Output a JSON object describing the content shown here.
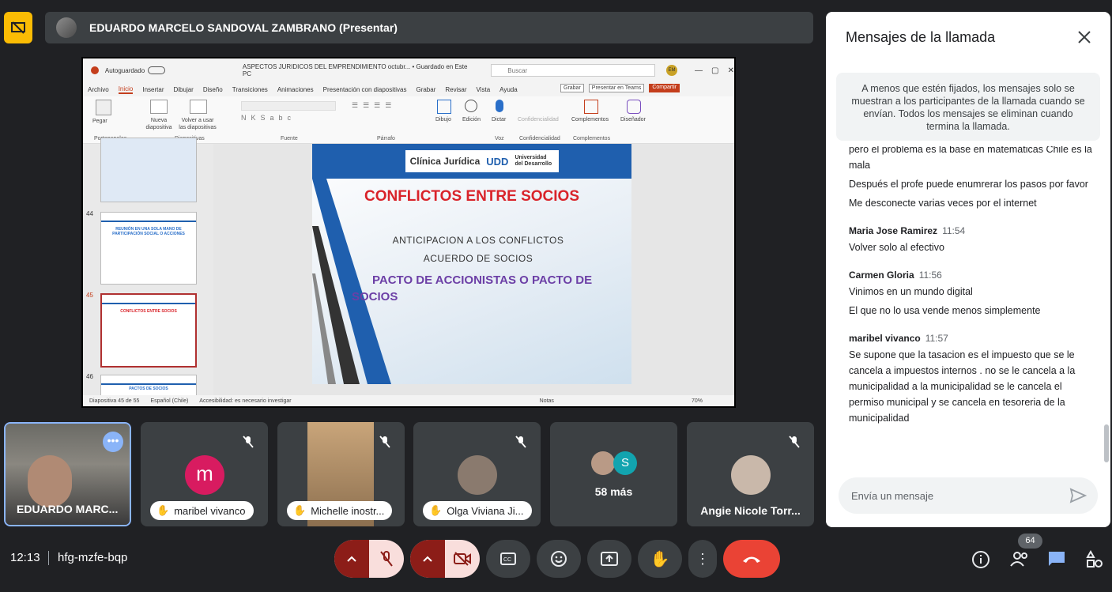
{
  "presenter": {
    "name": "EDUARDO MARCELO SANDOVAL ZAMBRANO (Presentar)"
  },
  "ppt": {
    "autosave": "Autoguardado",
    "doc_title": "ASPECTOS JURIDICOS DEL EMPRENDIMIENTO octubr...  •  Guardado en Este PC",
    "search_placeholder": "Buscar",
    "user_initials": "EM",
    "menu": [
      "Archivo",
      "Inicio",
      "Insertar",
      "Dibujar",
      "Diseño",
      "Transiciones",
      "Animaciones",
      "Presentación con diapositivas",
      "Grabar",
      "Revisar",
      "Vista",
      "Ayuda"
    ],
    "grabar_btn": "Grabar",
    "teams_btn": "Presentar en Teams",
    "share_btn": "Compartir",
    "ribbon_groups": [
      "Portapapeles",
      "Diapositivas",
      "Fuente",
      "Párrafo",
      "Voz",
      "Confidencialidad",
      "Complementos"
    ],
    "ribbon_buttons": [
      "Pegar",
      "Nueva diapositiva",
      "Volver a usar las diapositivas",
      "Dibujo",
      "Edición",
      "Dictar",
      "Confidencialidad",
      "Complementos",
      "Diseñador"
    ],
    "thumbs": [
      {
        "num": "44",
        "title": "REUNIÓN EN UNA SOLA MANO DE PARTICIPACIÓN SOCIAL O ACCIONES"
      },
      {
        "num": "45",
        "title": "CONFLICTOS ENTRE SOCIOS"
      },
      {
        "num": "46",
        "title": "PACTOS DE SOCIOS"
      }
    ],
    "status_slide": "Diapositiva 45 de 55",
    "status_lang": "Español (Chile)",
    "status_access": "Accesibilidad: es necesario investigar",
    "status_notes": "Notas",
    "status_zoom": "70%"
  },
  "slide": {
    "logo_left": "Clínica Jurídica",
    "logo_right": "Universidad del Desarrollo",
    "logo_mark": "UDD",
    "title": "CONFLICTOS ENTRE SOCIOS",
    "line1": "ANTICIPACION  A LOS CONFLICTOS",
    "line2": "ACUERDO DE SOCIOS",
    "line3": "PACTO DE ACCIONISTAS O PACTO DE SOCIOS"
  },
  "chat": {
    "title": "Mensajes de la llamada",
    "notice": "A menos que estén fijados, los mensajes solo se muestran a los participantes de la llamada cuando se envían. Todos los mensajes se eliminan cuando termina la llamada.",
    "partial_lines": [
      "pero el problema es la base en matemáticas Chile es la mala",
      "Después el profe puede enumrerar los pasos por favor",
      "Me desconecte varias veces por el internet"
    ],
    "groups": [
      {
        "sender": "Maria Jose Ramirez",
        "time": "11:54",
        "messages": [
          "Volver solo al efectivo"
        ]
      },
      {
        "sender": "Carmen Gloria",
        "time": "11:56",
        "messages": [
          "Vinimos en un mundo digital",
          "El que no lo usa vende menos simplemente"
        ]
      },
      {
        "sender": "maribel vivanco",
        "time": "11:57",
        "messages": [
          "Se supone que la tasacion es el impuesto que se le cancela a impuestos internos . no se le cancela a la municipalidad a la municipalidad se le cancela el permiso municipal y se cancela en tesoreria de la municipalidad"
        ]
      }
    ],
    "input_placeholder": "Envía un mensaje"
  },
  "tiles": [
    {
      "name": "EDUARDO MARC...",
      "type": "video-presenter"
    },
    {
      "name": "maribel vivanco",
      "initial": "m",
      "avatar_color": "#d81b60"
    },
    {
      "name": "Michelle inostr...",
      "type": "video"
    },
    {
      "name": "Olga Viviana Ji...",
      "type": "photo"
    },
    {
      "name": "58 más",
      "badge": "S"
    },
    {
      "name": "Angie Nicole Torr...",
      "type": "photo"
    }
  ],
  "bottom": {
    "clock": "12:13",
    "meeting_code": "hfg-mzfe-bqp",
    "participants_count": "64"
  },
  "colors": {
    "end_call": "#ea4335",
    "muted_bg": "#f9dedc",
    "muted_side": "#8c1d18",
    "accent": "#8ab4f8",
    "presenter_yellow": "#fbbc04"
  }
}
